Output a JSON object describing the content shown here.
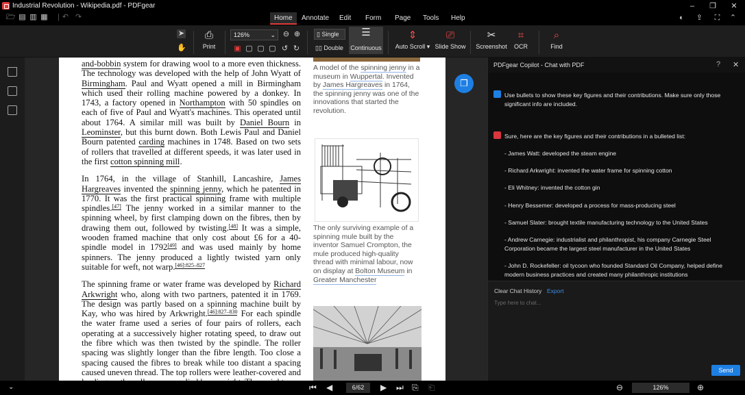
{
  "app": {
    "window_title": "Industrial Revolution - Wikipedia.pdf - PDFgear"
  },
  "menu": {
    "tabs": [
      "Home",
      "Annotate",
      "Edit",
      "Form",
      "Page",
      "Tools",
      "Help"
    ]
  },
  "ribbon": {
    "print_label": "Print",
    "zoom_value": "126%",
    "single_label": "Single",
    "double_label": "Double",
    "continuous_label": "Continuous",
    "auto_scroll_label": "Auto Scroll",
    "slide_show_label": "Slide Show",
    "screenshot_label": "Screenshot",
    "ocr_label": "OCR",
    "find_label": "Find"
  },
  "document": {
    "para1": [
      {
        "t": "and-bobbin",
        "link": true
      },
      {
        "t": " system for drawing wool to a more even thickness. The technology was developed with the help of John Wyatt of "
      },
      {
        "t": "Birmingham",
        "link": true
      },
      {
        "t": ". Paul and Wyatt opened a mill in Birmingham which used their rolling machine powered by a donkey. In 1743, a factory opened in "
      },
      {
        "t": "Northampton",
        "link": true
      },
      {
        "t": " with 50 spindles on each of five of Paul and Wyatt's machines. This operated until about 1764. A similar mill was built by "
      },
      {
        "t": "Daniel Bourn",
        "link": true
      },
      {
        "t": " in "
      },
      {
        "t": "Leominster",
        "link": true
      },
      {
        "t": ", but this burnt down. Both Lewis Paul and Daniel Bourn patented "
      },
      {
        "t": "carding",
        "link": true
      },
      {
        "t": " machines in 1748. Based on two sets of rollers that travelled at different speeds, it was later used in the first "
      },
      {
        "t": "cotton spinning mill",
        "link": true
      },
      {
        "t": "."
      }
    ],
    "para2": [
      {
        "t": "In 1764, in the village of Stanhill, Lancashire, "
      },
      {
        "t": "James Hargreaves",
        "link": true
      },
      {
        "t": " invented the "
      },
      {
        "t": "spinning jenny",
        "link": true
      },
      {
        "t": ", which he patented in 1770. It was the first practical spinning frame with multiple spindles."
      },
      {
        "t": "[47]",
        "sup": true
      },
      {
        "t": " The jenny worked in a similar manner to the spinning wheel, by first clamping down on the fibres, then by drawing them out, followed by twisting."
      },
      {
        "t": "[48]",
        "sup": true
      },
      {
        "t": " It was a simple, wooden framed machine that only cost about £6 for a 40-spindle model in 1792"
      },
      {
        "t": "[49]",
        "sup": true
      },
      {
        "t": " and was used mainly by home spinners. The jenny produced a lightly twisted yarn only suitable for weft, not warp."
      },
      {
        "t": "[46]:825–827",
        "sup": true
      }
    ],
    "para3": [
      {
        "t": "The spinning frame or water frame was developed by "
      },
      {
        "t": "Richard Arkwright",
        "link": true
      },
      {
        "t": " who, along with two partners, patented it in 1769. The design was partly based on a spinning machine built by Kay, who was hired by Arkwright."
      },
      {
        "t": "[46]:827–830",
        "sup": true
      },
      {
        "t": " For each spindle the water frame used a series of four pairs of rollers, each operating at a successively higher rotating speed, to draw out the fibre which was then twisted by the spindle. The roller spacing was slightly longer than the fibre length. Too close a spacing caused the fibres to break while too distant a spacing caused uneven thread. The top rollers were leather-covered and loading on the rollers was applied by a weight. The weights"
      }
    ],
    "caption1": [
      {
        "t": "A model of the "
      },
      {
        "t": "spinning jenny",
        "link": true
      },
      {
        "t": " in a museum in "
      },
      {
        "t": "Wuppertal",
        "link": true
      },
      {
        "t": ". Invented by "
      },
      {
        "t": "James Hargreaves",
        "link": true
      },
      {
        "t": " in 1764, the spinning jenny was one of the innovations that started the revolution."
      }
    ],
    "caption2": [
      {
        "t": "The only surviving example of a spinning mule built by the inventor Samuel Crompton, the mule produced high-quality thread with minimal labour, now on display at "
      },
      {
        "t": "Bolton Museum",
        "link": true
      },
      {
        "t": " in "
      },
      {
        "t": "Greater Manchester",
        "link": true
      }
    ]
  },
  "chat": {
    "title": "PDFgear Copilot - Chat with PDF",
    "user_message": "Use bullets to show these key figures and their contributions. Make sure only those significant info are included.",
    "bot_intro": "Sure, here are the key figures and their contributions in a bulleted list:",
    "bullets": [
      "- James Watt: developed the steam engine",
      "- Richard Arkwright: invented the water frame for spinning cotton",
      "- Eli Whitney: invented the cotton gin",
      "- Henry Bessemer: developed a process for mass-producing steel",
      "- Samuel Slater: brought textile manufacturing technology to the United States",
      "- Andrew Carnegie: industrialist and philanthropist, his company Carnegie Steel Corporation became the largest steel manufacturer in the United States",
      "- John D. Rockefeller: oil tycoon who founded Standard Oil Company, helped define modern business practices and created many philanthropic institutions"
    ],
    "clear_history": "Clear Chat History",
    "export": "Export",
    "input_placeholder": "Type here to chat...",
    "send_label": "Send"
  },
  "status": {
    "page_indicator": "6/62",
    "zoom": "126%"
  },
  "colors": {
    "accent_blue": "#1e7fe3",
    "accent_red": "#e23b3b"
  }
}
